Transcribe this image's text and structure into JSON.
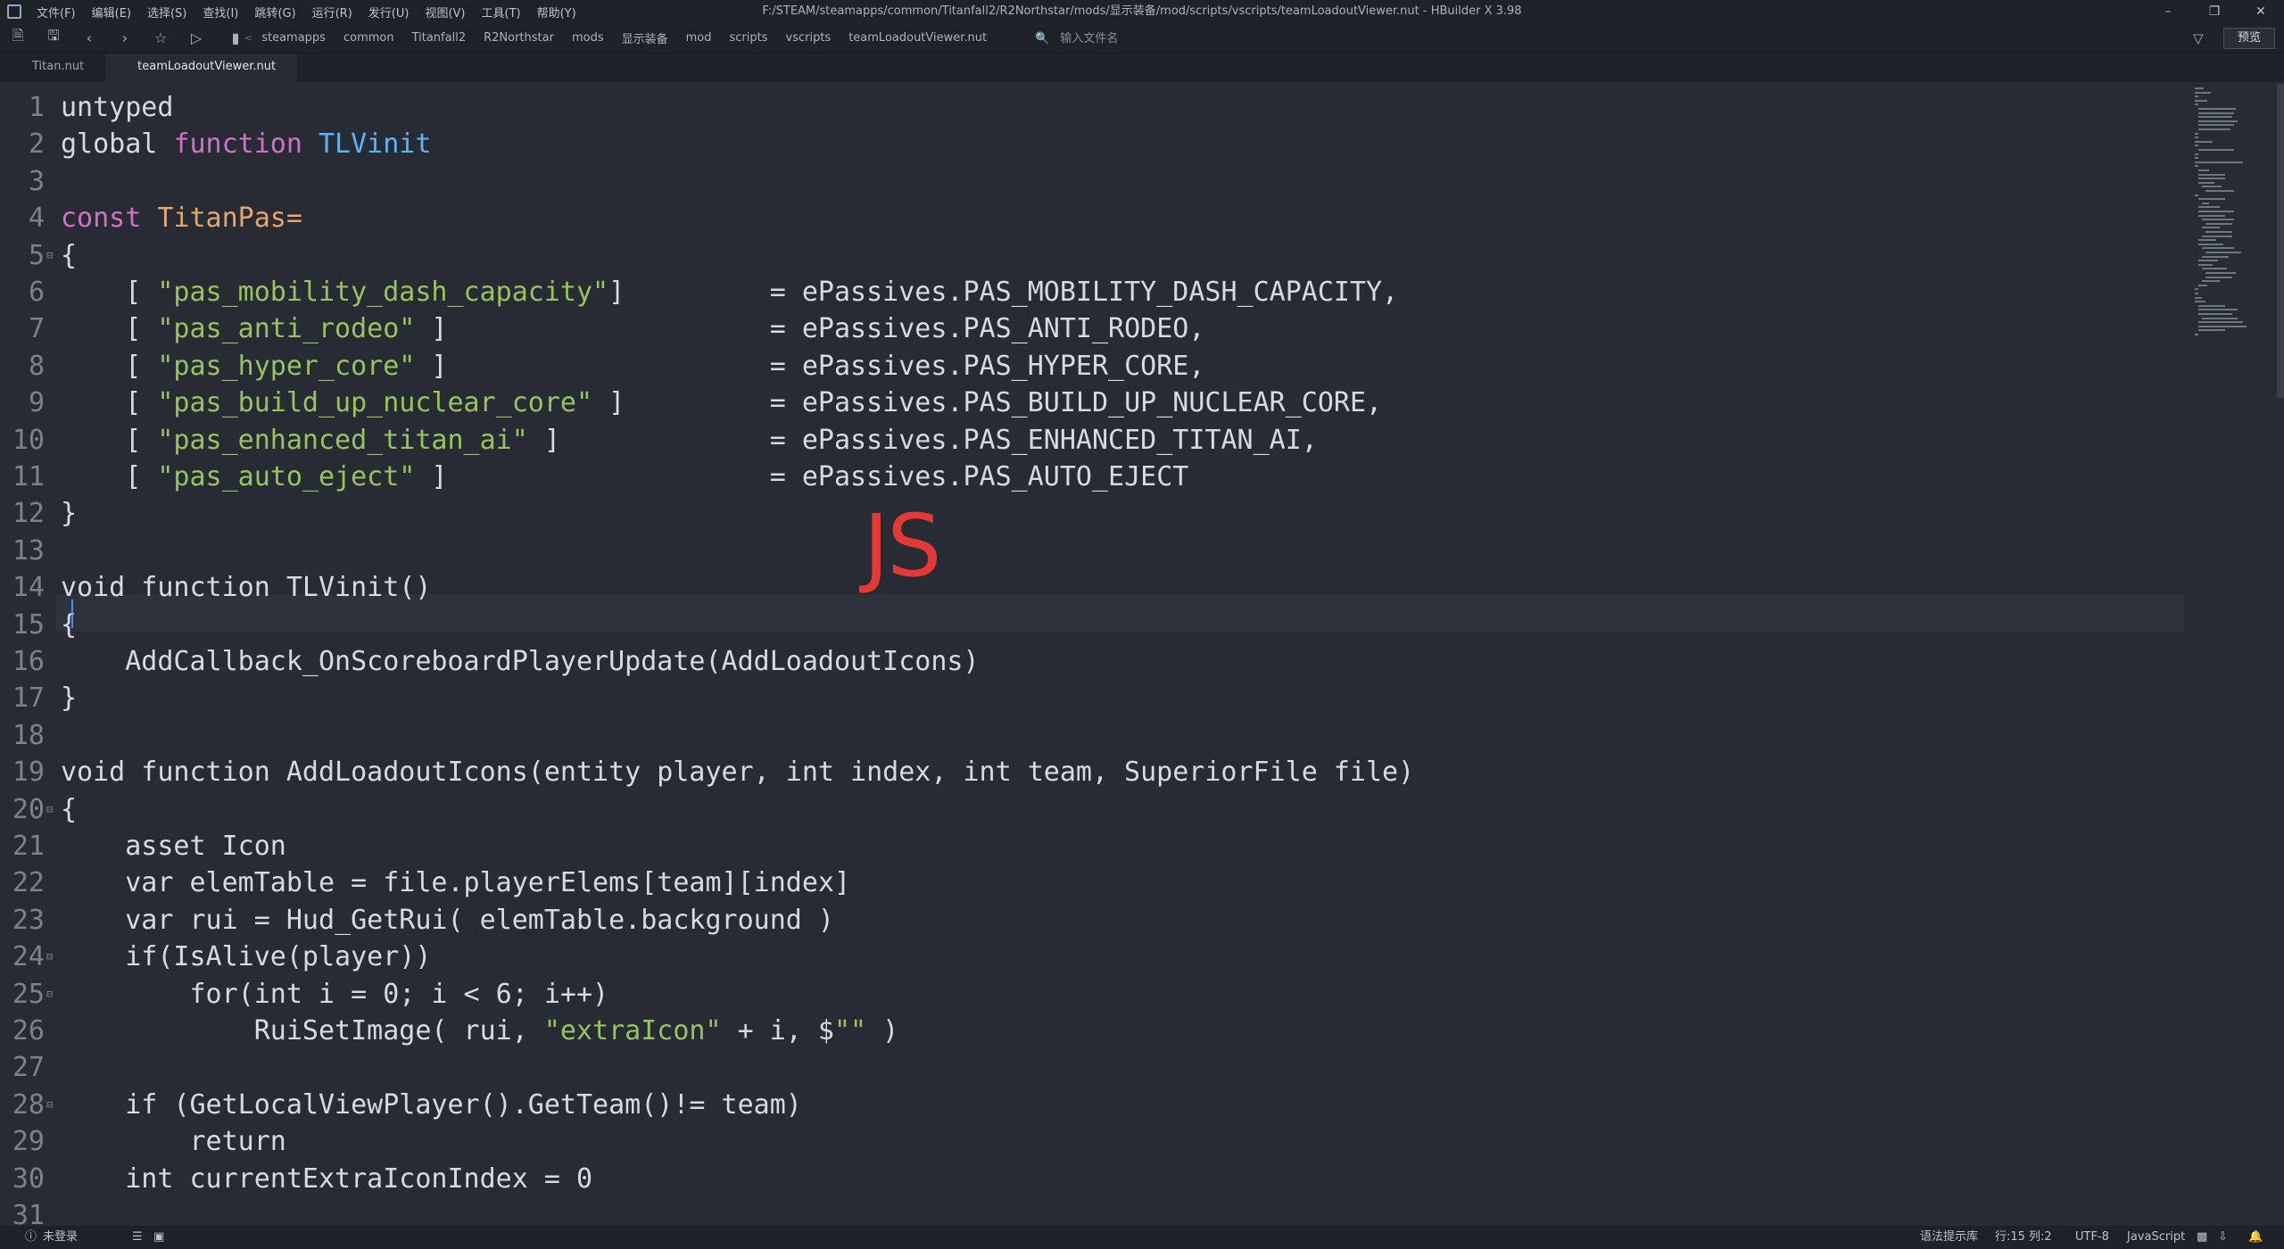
{
  "window": {
    "title": "F:/STEAM/steamapps/common/Titanfall2/R2Northstar/mods/显示装备/mod/scripts/vscripts/teamLoadoutViewer.nut - HBuilder X 3.98"
  },
  "menu": [
    "文件(F)",
    "编辑(E)",
    "选择(S)",
    "查找(I)",
    "跳转(G)",
    "运行(R)",
    "发行(U)",
    "视图(V)",
    "工具(T)",
    "帮助(Y)"
  ],
  "breadcrumb": [
    "steamapps",
    "common",
    "Titanfall2",
    "R2Northstar",
    "mods",
    "显示装备",
    "mod",
    "scripts",
    "vscripts",
    "teamLoadoutViewer.nut"
  ],
  "search": {
    "placeholder": "输入文件名"
  },
  "toolbar": {
    "preview_label": "预览"
  },
  "tabs": [
    {
      "label": "Titan.nut",
      "active": false
    },
    {
      "label": "teamLoadoutViewer.nut",
      "active": true
    }
  ],
  "editor": {
    "current_line": 15,
    "overlay_text": "JS",
    "lines": [
      {
        "n": "1",
        "fold": false,
        "code": "untyped"
      },
      {
        "n": "2",
        "fold": false,
        "code": "global function TLVinit"
      },
      {
        "n": "3",
        "fold": false,
        "code": ""
      },
      {
        "n": "4",
        "fold": false,
        "code": "const TitanPas="
      },
      {
        "n": "5",
        "fold": true,
        "code": "{"
      },
      {
        "n": "6",
        "fold": false,
        "code": "    [ \"pas_mobility_dash_capacity\"]         = ePassives.PAS_MOBILITY_DASH_CAPACITY,"
      },
      {
        "n": "7",
        "fold": false,
        "code": "    [ \"pas_anti_rodeo\" ]                    = ePassives.PAS_ANTI_RODEO,"
      },
      {
        "n": "8",
        "fold": false,
        "code": "    [ \"pas_hyper_core\" ]                    = ePassives.PAS_HYPER_CORE,"
      },
      {
        "n": "9",
        "fold": false,
        "code": "    [ \"pas_build_up_nuclear_core\" ]         = ePassives.PAS_BUILD_UP_NUCLEAR_CORE,"
      },
      {
        "n": "10",
        "fold": false,
        "code": "    [ \"pas_enhanced_titan_ai\" ]             = ePassives.PAS_ENHANCED_TITAN_AI,"
      },
      {
        "n": "11",
        "fold": false,
        "code": "    [ \"pas_auto_eject\" ]                    = ePassives.PAS_AUTO_EJECT"
      },
      {
        "n": "12",
        "fold": false,
        "code": "}"
      },
      {
        "n": "13",
        "fold": false,
        "code": ""
      },
      {
        "n": "14",
        "fold": false,
        "code": "void function TLVinit()"
      },
      {
        "n": "15",
        "fold": false,
        "code": "{"
      },
      {
        "n": "16",
        "fold": false,
        "code": "    AddCallback_OnScoreboardPlayerUpdate(AddLoadoutIcons)"
      },
      {
        "n": "17",
        "fold": false,
        "code": "}"
      },
      {
        "n": "18",
        "fold": false,
        "code": ""
      },
      {
        "n": "19",
        "fold": false,
        "code": "void function AddLoadoutIcons(entity player, int index, int team, SuperiorFile file)"
      },
      {
        "n": "20",
        "fold": true,
        "code": "{"
      },
      {
        "n": "21",
        "fold": false,
        "code": "    asset Icon"
      },
      {
        "n": "22",
        "fold": false,
        "code": "    var elemTable = file.playerElems[team][index]"
      },
      {
        "n": "23",
        "fold": false,
        "code": "    var rui = Hud_GetRui( elemTable.background )"
      },
      {
        "n": "24",
        "fold": true,
        "code": "    if(IsAlive(player))"
      },
      {
        "n": "25",
        "fold": true,
        "code": "        for(int i = 0; i < 6; i++)"
      },
      {
        "n": "26",
        "fold": false,
        "code": "            RuiSetImage( rui, \"extraIcon\" + i, $\"\" )"
      },
      {
        "n": "27",
        "fold": false,
        "code": ""
      },
      {
        "n": "28",
        "fold": true,
        "code": "    if (GetLocalViewPlayer().GetTeam()!= team)"
      },
      {
        "n": "29",
        "fold": false,
        "code": "        return"
      },
      {
        "n": "30",
        "fold": false,
        "code": "    int currentExtraIconIndex = 0"
      },
      {
        "n": "31",
        "fold": false,
        "code": ""
      }
    ]
  },
  "statusbar": {
    "login": "未登录",
    "hint": "语法提示库",
    "position": "行:15  列:2",
    "encoding": "UTF-8",
    "language": "JavaScript"
  },
  "colors": {
    "keyword": "#d470c9",
    "function_name": "#5fb3f5",
    "definition": "#e8a46a",
    "string": "#98c35f",
    "overlay": "#e53935"
  }
}
